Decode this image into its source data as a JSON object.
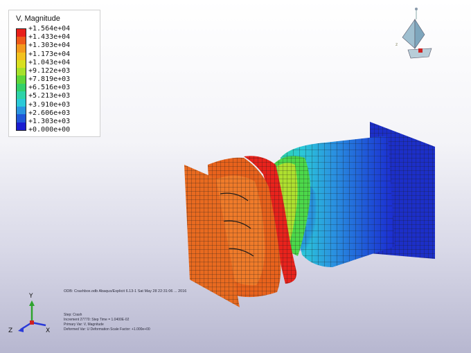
{
  "legend": {
    "title": "V, Magnitude",
    "labels": [
      "+1.564e+04",
      "+1.433e+04",
      "+1.303e+04",
      "+1.173e+04",
      "+1.043e+04",
      "+9.122e+03",
      "+7.819e+03",
      "+6.516e+03",
      "+5.213e+03",
      "+3.910e+03",
      "+2.606e+03",
      "+1.303e+03",
      "+0.000e+00"
    ],
    "colors": [
      "#e8201a",
      "#ef5a1a",
      "#f39a1e",
      "#f2c21f",
      "#d8e021",
      "#a6e12a",
      "#5fd639",
      "#33d06a",
      "#2ed3a8",
      "#2bc9d8",
      "#2a94e0",
      "#1f57d8",
      "#1b1ed0"
    ]
  },
  "info": {
    "odb": "ODB: Crashbox.odb   Abaqus/Explicit 6.13-1   Sat May 28 22:31:06 ...  2016",
    "step": "Step: Crash",
    "increment": "Increment    27770: Step Time =    1.0400E-02",
    "primary_var": "Primary Var: V, Magnitude",
    "deformed_var": "Deformed Var: U   Deformation Scale Factor: +1.000e+00"
  },
  "triad": {
    "x": "X",
    "y": "Y",
    "z": "Z"
  },
  "view_widget": {
    "axis_label": "z"
  }
}
